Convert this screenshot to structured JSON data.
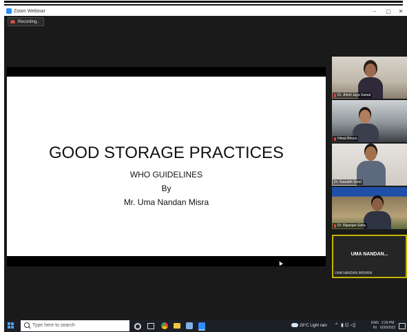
{
  "window": {
    "title": "Zoom Webinar",
    "controls": {
      "minimize": "–",
      "maximize": "▢",
      "close": "✕"
    }
  },
  "recording": {
    "label": "Recording..",
    "icon": "recording-icon"
  },
  "slide": {
    "title": "GOOD STORAGE PRACTICES",
    "line1": "WHO GUIDELINES",
    "line2": "By",
    "line3": "Mr. Uma Nandan Misra"
  },
  "participants": [
    {
      "name": "Dr. Jhimli Jaya Samal",
      "mic_muted": true
    },
    {
      "name": "Himal Bhuvo",
      "mic_muted": true
    },
    {
      "name": "Dr. Saurabh Sood",
      "mic_muted": false
    },
    {
      "name": "Dr. Dipanjan Saha",
      "mic_muted": true
    }
  ],
  "active_speaker": {
    "display": "UMA NANDAN...",
    "name": "UMA NANDAN MISHRA",
    "highlight": "#c6b300"
  },
  "taskbar": {
    "search_placeholder": "Type here to search",
    "weather": "28°C Light rain",
    "tray_chevron": "^",
    "tray_icons": "▮ ⊡ ◁)",
    "lang_line1": "ENG",
    "lang_line2": "IN",
    "time": "2:26 PM",
    "date": "6/30/2022"
  },
  "colors": {
    "window_bg": "#1a1a1a",
    "zoom_blue": "#2d8cff",
    "taskbar_bg": "#1c1f26",
    "mic_muted": "#e2453a"
  }
}
